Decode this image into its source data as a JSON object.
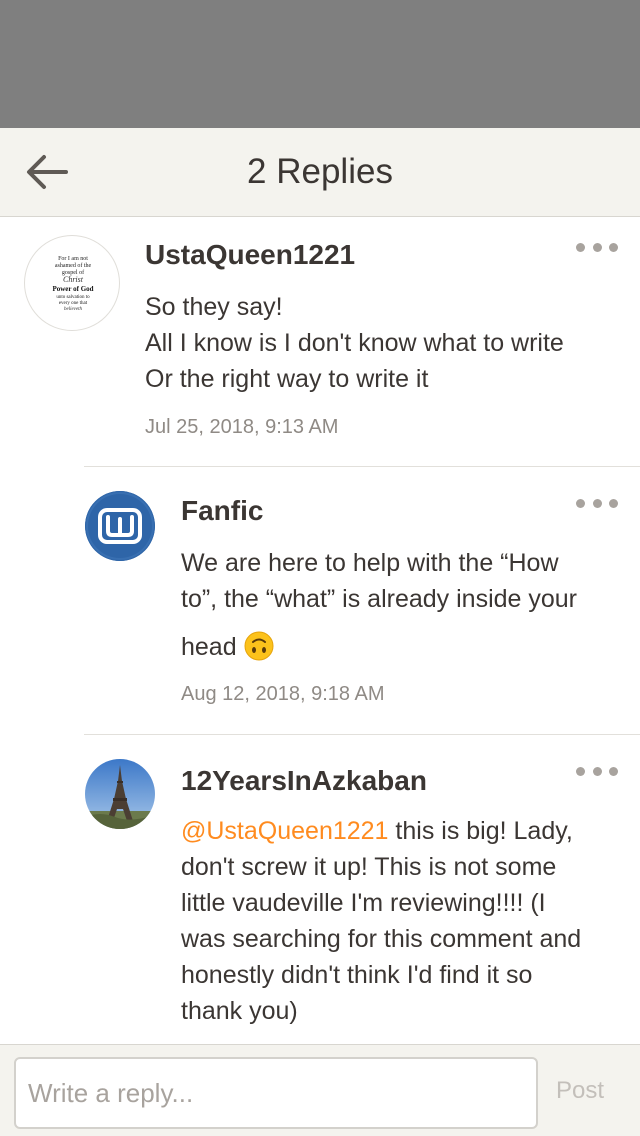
{
  "header": {
    "title": "2 Replies",
    "back_icon": "arrow-left-icon"
  },
  "comments": [
    {
      "username": "UstaQueen1221",
      "lines": [
        "So they say!",
        "All I know is I don't know what to write",
        "Or the right way to write it"
      ],
      "timestamp": "Jul 25, 2018, 9:13 AM",
      "avatar_text": [
        "For I am not",
        "ashamed of the",
        "gospel of",
        "Christ",
        "Power of God",
        "unto salvation to",
        "every one that",
        "believeth"
      ]
    },
    {
      "username": "Fanfic",
      "text_line1": "We are here to help with the “How",
      "text_line2": "to”, the “what” is already inside your",
      "text_line3": "head",
      "emoji": "upside-down-face",
      "timestamp": "Aug 12, 2018, 9:18 AM",
      "avatar_letter": "w"
    },
    {
      "username": "12YearsInAzkaban",
      "mention": "@UstaQueen1221",
      "text_after_mention": " this is big! Lady,",
      "lines": [
        "don't screw it up! This is not some",
        "little vaudeville I'm reviewing!!!! (I",
        "was searching for this comment and",
        "honestly didn't think I'd find it so",
        "thank you)"
      ]
    }
  ],
  "reply_bar": {
    "placeholder": "Write a reply...",
    "post_label": "Post"
  },
  "colors": {
    "accent": "#ff8b1f",
    "header_bg": "#f4f3ee",
    "status_bg": "#7f7f7f",
    "fanfic_avatar": "#2e65a8"
  }
}
